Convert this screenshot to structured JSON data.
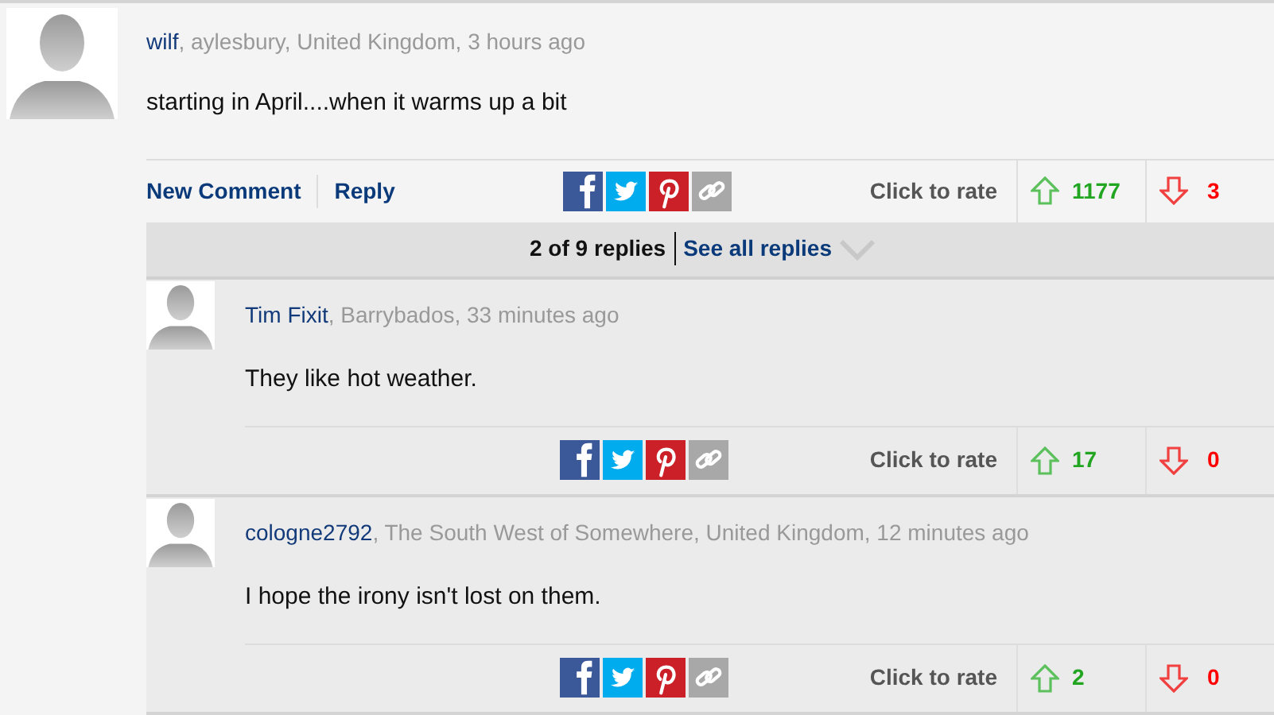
{
  "comment": {
    "author": "wilf",
    "meta": ", aylesbury, United Kingdom, 3 hours ago",
    "text": "starting in April....when it warms up a bit",
    "actions": [
      "New Comment",
      "Reply"
    ],
    "rate_label": "Click to rate",
    "up": "1177",
    "down": "3"
  },
  "replies_bar": {
    "count": "2 of 9 replies",
    "link": "See all replies"
  },
  "replies": [
    {
      "author": "Tim Fixit",
      "meta": ", Barrybados, 33 minutes ago",
      "text": "They like hot weather.",
      "rate_label": "Click to rate",
      "up": "17",
      "down": "0"
    },
    {
      "author": "cologne2792",
      "meta": ", The South West of Somewhere, United Kingdom, 12 minutes ago",
      "text": "I hope the irony isn't lost on them.",
      "rate_label": "Click to rate",
      "up": "2",
      "down": "0"
    }
  ]
}
